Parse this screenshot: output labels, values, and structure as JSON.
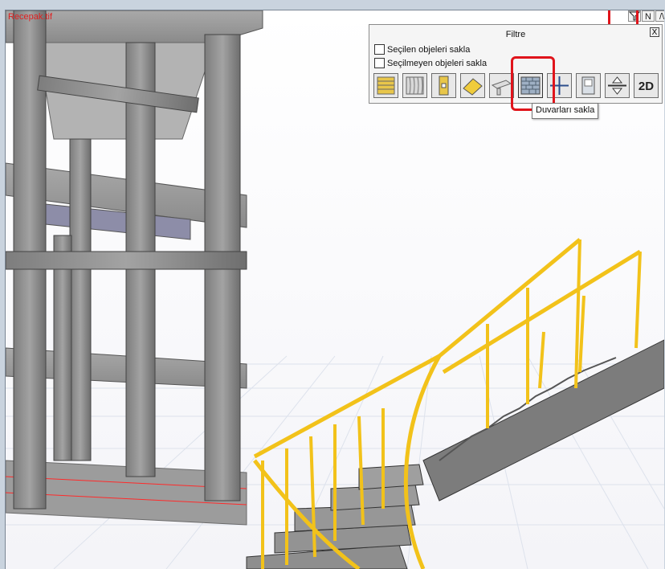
{
  "viewport": {
    "title": "Recepak.tif",
    "background": "#ffffff"
  },
  "corner_buttons": {
    "filter_icon": "funnel-icon",
    "north_label": "N",
    "view_up_label": "/\\"
  },
  "filter_panel": {
    "title": "Filtre",
    "close_label": "X",
    "hide_selected_label": "Seçilen objeleri sakla",
    "hide_selected_checked": false,
    "hide_unselected_label": "Seçilmeyen objeleri sakla",
    "hide_unselected_checked": false,
    "tools": [
      {
        "icon": "slab-icon"
      },
      {
        "icon": "curtain-icon"
      },
      {
        "icon": "column-icon"
      },
      {
        "icon": "roof-icon"
      },
      {
        "icon": "beam-icon"
      },
      {
        "icon": "wall-icon",
        "active": true
      },
      {
        "icon": "grid-axis-icon"
      },
      {
        "icon": "door-icon"
      },
      {
        "icon": "level-icon"
      },
      {
        "icon": "2d-icon",
        "label": "2D"
      }
    ],
    "tooltip": "Duvarları sakla"
  },
  "colors": {
    "highlight": "#e0141b",
    "concrete": "#8f8f8f",
    "railing": "#f2c21a",
    "grid_line": "#ff2a2a"
  }
}
